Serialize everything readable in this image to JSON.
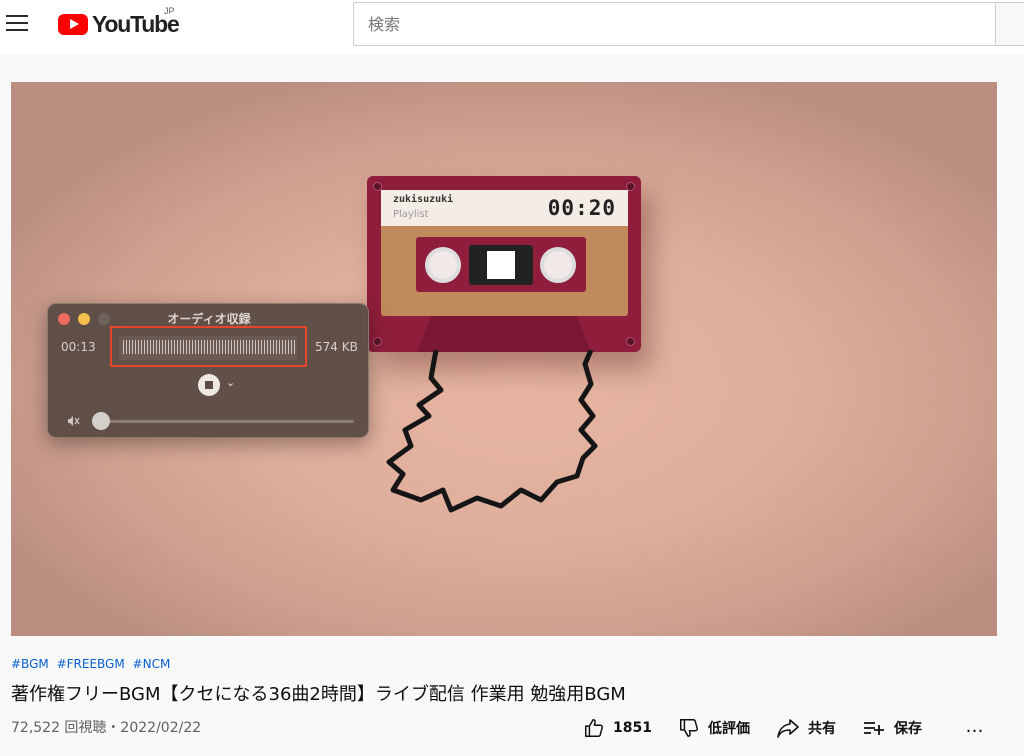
{
  "header": {
    "logo_text": "YouTube",
    "country_code": "JP",
    "search_placeholder": "検索",
    "brand_color": "#ff0000"
  },
  "player": {
    "cassette": {
      "artist": "zukisuzuki",
      "subtitle": "Playlist",
      "time": "00:20"
    },
    "recorder": {
      "title": "オーディオ収録",
      "elapsed": "00:13",
      "file_size": "574 KB",
      "volume_level": 0.02
    }
  },
  "video": {
    "hashtags": [
      "#BGM",
      "#FREEBGM",
      "#NCM"
    ],
    "title": "著作権フリーBGM【クセになる36曲2時間】ライブ配信 作業用 勉強用BGM",
    "views_and_date": "72,522 回視聴・2022/02/22",
    "actions": {
      "like_count": "1851",
      "dislike_label": "低評価",
      "share_label": "共有",
      "save_label": "保存",
      "more_label": "…"
    }
  },
  "colors": {
    "link": "#065fd4",
    "highlight_box": "#e8442a"
  }
}
